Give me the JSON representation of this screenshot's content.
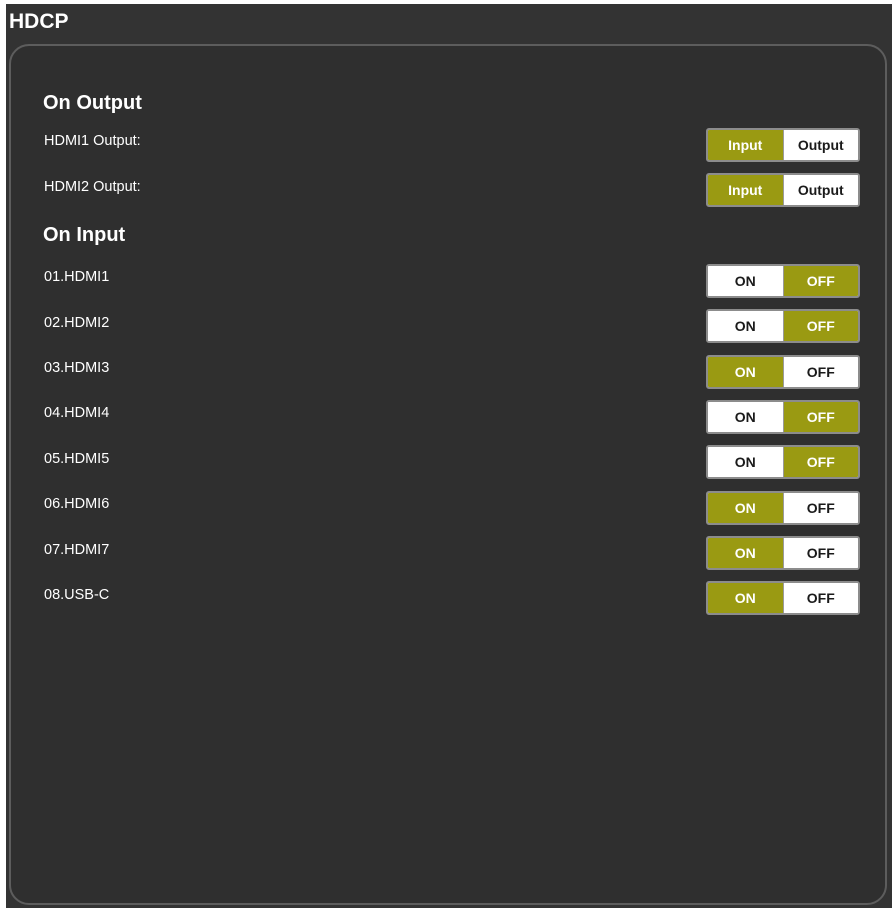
{
  "header": {
    "title": "HDCP"
  },
  "colors": {
    "active": "#9a9a12",
    "background": "#333333",
    "text": "#ffffff"
  },
  "on_output": {
    "title": "On Output",
    "rows": [
      {
        "label": "HDMI1 Output:",
        "option_a": "Input",
        "option_b": "Output",
        "selected": "Input"
      },
      {
        "label": "HDMI2 Output:",
        "option_a": "Input",
        "option_b": "Output",
        "selected": "Input"
      }
    ]
  },
  "on_input": {
    "title": "On Input",
    "rows": [
      {
        "label": "01.HDMI1",
        "on": "ON",
        "off": "OFF",
        "selected": "OFF"
      },
      {
        "label": "02.HDMI2",
        "on": "ON",
        "off": "OFF",
        "selected": "OFF"
      },
      {
        "label": "03.HDMI3",
        "on": "ON",
        "off": "OFF",
        "selected": "ON"
      },
      {
        "label": "04.HDMI4",
        "on": "ON",
        "off": "OFF",
        "selected": "OFF"
      },
      {
        "label": "05.HDMI5",
        "on": "ON",
        "off": "OFF",
        "selected": "OFF"
      },
      {
        "label": "06.HDMI6",
        "on": "ON",
        "off": "OFF",
        "selected": "ON"
      },
      {
        "label": "07.HDMI7",
        "on": "ON",
        "off": "OFF",
        "selected": "ON"
      },
      {
        "label": "08.USB-C",
        "on": "ON",
        "off": "OFF",
        "selected": "ON"
      }
    ]
  }
}
